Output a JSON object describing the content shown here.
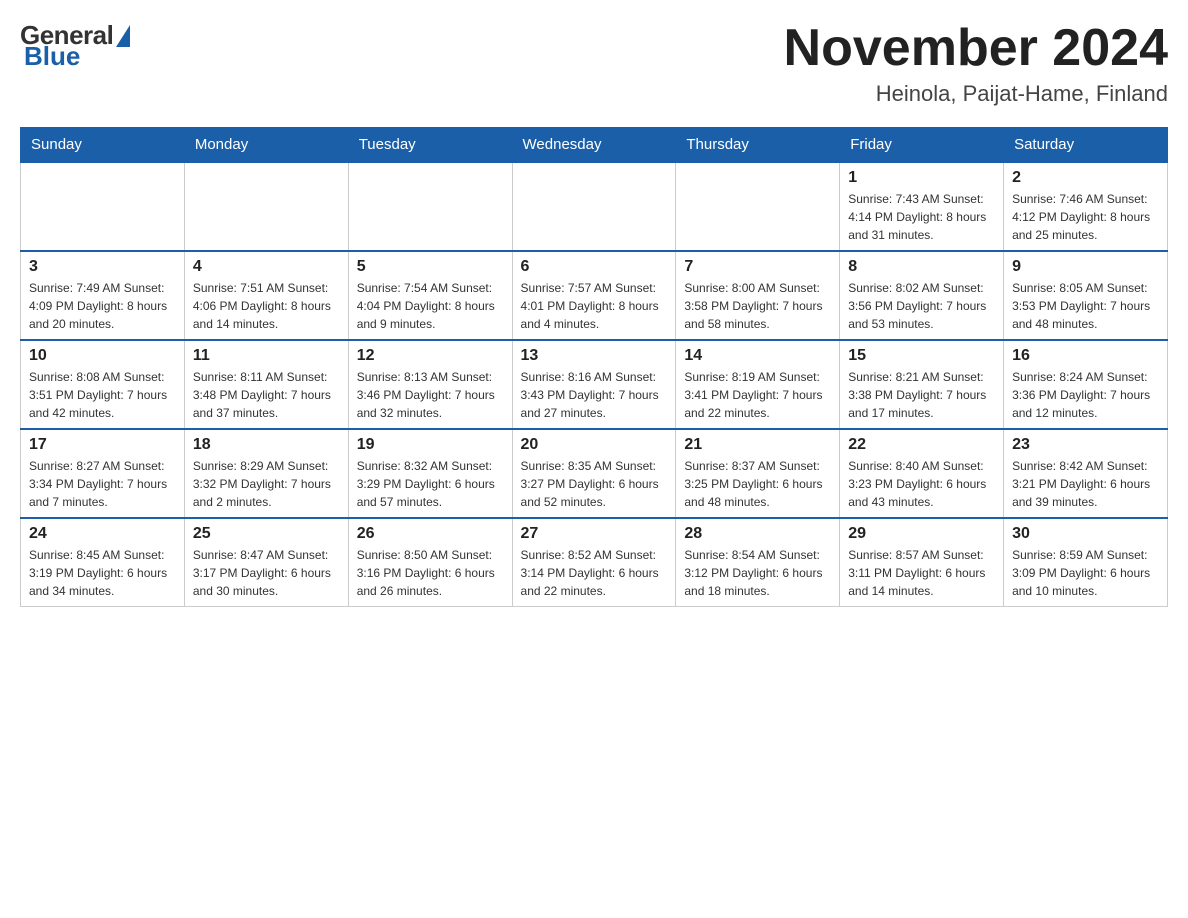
{
  "logo": {
    "general": "General",
    "blue": "Blue"
  },
  "title": "November 2024",
  "location": "Heinola, Paijat-Hame, Finland",
  "days_of_week": [
    "Sunday",
    "Monday",
    "Tuesday",
    "Wednesday",
    "Thursday",
    "Friday",
    "Saturday"
  ],
  "weeks": [
    [
      {
        "day": "",
        "info": ""
      },
      {
        "day": "",
        "info": ""
      },
      {
        "day": "",
        "info": ""
      },
      {
        "day": "",
        "info": ""
      },
      {
        "day": "",
        "info": ""
      },
      {
        "day": "1",
        "info": "Sunrise: 7:43 AM\nSunset: 4:14 PM\nDaylight: 8 hours\nand 31 minutes."
      },
      {
        "day": "2",
        "info": "Sunrise: 7:46 AM\nSunset: 4:12 PM\nDaylight: 8 hours\nand 25 minutes."
      }
    ],
    [
      {
        "day": "3",
        "info": "Sunrise: 7:49 AM\nSunset: 4:09 PM\nDaylight: 8 hours\nand 20 minutes."
      },
      {
        "day": "4",
        "info": "Sunrise: 7:51 AM\nSunset: 4:06 PM\nDaylight: 8 hours\nand 14 minutes."
      },
      {
        "day": "5",
        "info": "Sunrise: 7:54 AM\nSunset: 4:04 PM\nDaylight: 8 hours\nand 9 minutes."
      },
      {
        "day": "6",
        "info": "Sunrise: 7:57 AM\nSunset: 4:01 PM\nDaylight: 8 hours\nand 4 minutes."
      },
      {
        "day": "7",
        "info": "Sunrise: 8:00 AM\nSunset: 3:58 PM\nDaylight: 7 hours\nand 58 minutes."
      },
      {
        "day": "8",
        "info": "Sunrise: 8:02 AM\nSunset: 3:56 PM\nDaylight: 7 hours\nand 53 minutes."
      },
      {
        "day": "9",
        "info": "Sunrise: 8:05 AM\nSunset: 3:53 PM\nDaylight: 7 hours\nand 48 minutes."
      }
    ],
    [
      {
        "day": "10",
        "info": "Sunrise: 8:08 AM\nSunset: 3:51 PM\nDaylight: 7 hours\nand 42 minutes."
      },
      {
        "day": "11",
        "info": "Sunrise: 8:11 AM\nSunset: 3:48 PM\nDaylight: 7 hours\nand 37 minutes."
      },
      {
        "day": "12",
        "info": "Sunrise: 8:13 AM\nSunset: 3:46 PM\nDaylight: 7 hours\nand 32 minutes."
      },
      {
        "day": "13",
        "info": "Sunrise: 8:16 AM\nSunset: 3:43 PM\nDaylight: 7 hours\nand 27 minutes."
      },
      {
        "day": "14",
        "info": "Sunrise: 8:19 AM\nSunset: 3:41 PM\nDaylight: 7 hours\nand 22 minutes."
      },
      {
        "day": "15",
        "info": "Sunrise: 8:21 AM\nSunset: 3:38 PM\nDaylight: 7 hours\nand 17 minutes."
      },
      {
        "day": "16",
        "info": "Sunrise: 8:24 AM\nSunset: 3:36 PM\nDaylight: 7 hours\nand 12 minutes."
      }
    ],
    [
      {
        "day": "17",
        "info": "Sunrise: 8:27 AM\nSunset: 3:34 PM\nDaylight: 7 hours\nand 7 minutes."
      },
      {
        "day": "18",
        "info": "Sunrise: 8:29 AM\nSunset: 3:32 PM\nDaylight: 7 hours\nand 2 minutes."
      },
      {
        "day": "19",
        "info": "Sunrise: 8:32 AM\nSunset: 3:29 PM\nDaylight: 6 hours\nand 57 minutes."
      },
      {
        "day": "20",
        "info": "Sunrise: 8:35 AM\nSunset: 3:27 PM\nDaylight: 6 hours\nand 52 minutes."
      },
      {
        "day": "21",
        "info": "Sunrise: 8:37 AM\nSunset: 3:25 PM\nDaylight: 6 hours\nand 48 minutes."
      },
      {
        "day": "22",
        "info": "Sunrise: 8:40 AM\nSunset: 3:23 PM\nDaylight: 6 hours\nand 43 minutes."
      },
      {
        "day": "23",
        "info": "Sunrise: 8:42 AM\nSunset: 3:21 PM\nDaylight: 6 hours\nand 39 minutes."
      }
    ],
    [
      {
        "day": "24",
        "info": "Sunrise: 8:45 AM\nSunset: 3:19 PM\nDaylight: 6 hours\nand 34 minutes."
      },
      {
        "day": "25",
        "info": "Sunrise: 8:47 AM\nSunset: 3:17 PM\nDaylight: 6 hours\nand 30 minutes."
      },
      {
        "day": "26",
        "info": "Sunrise: 8:50 AM\nSunset: 3:16 PM\nDaylight: 6 hours\nand 26 minutes."
      },
      {
        "day": "27",
        "info": "Sunrise: 8:52 AM\nSunset: 3:14 PM\nDaylight: 6 hours\nand 22 minutes."
      },
      {
        "day": "28",
        "info": "Sunrise: 8:54 AM\nSunset: 3:12 PM\nDaylight: 6 hours\nand 18 minutes."
      },
      {
        "day": "29",
        "info": "Sunrise: 8:57 AM\nSunset: 3:11 PM\nDaylight: 6 hours\nand 14 minutes."
      },
      {
        "day": "30",
        "info": "Sunrise: 8:59 AM\nSunset: 3:09 PM\nDaylight: 6 hours\nand 10 minutes."
      }
    ]
  ]
}
